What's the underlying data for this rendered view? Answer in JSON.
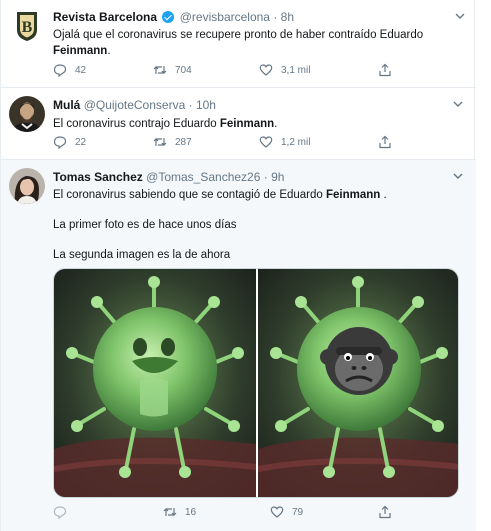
{
  "tweets": [
    {
      "name": "Revista Barcelona",
      "handle": "@revisbarcelona",
      "dot": "·",
      "time": "8h",
      "text_before": "Ojalá que el coronavirus se recupere pronto de haber contraído Eduardo ",
      "text_bold": "Feinmann",
      "text_after": ".",
      "reply_count": "42",
      "retweet_count": "704",
      "like_count": "3,1 mil"
    },
    {
      "name": "Mulá",
      "handle": "@QuijoteConserva",
      "dot": "·",
      "time": "10h",
      "text_before": "El coronavirus contrajo Eduardo ",
      "text_bold": "Feinmann",
      "text_after": ".",
      "reply_count": "22",
      "retweet_count": "287",
      "like_count": "1,2 mil"
    },
    {
      "name": "Tomas Sanchez",
      "handle": "@Tomas_Sanchez26",
      "dot": "·",
      "time": "9h",
      "text_before": "El coronavirus sabiendo que se contagió de Eduardo ",
      "text_bold": "Feinmann",
      "text_after": " .",
      "line2": "La primer foto es de hace unos días",
      "line3": "La segunda imagen es la de ahora",
      "reply_count": "",
      "retweet_count": "16",
      "like_count": "79"
    }
  ],
  "icons": {
    "reply": "reply-icon",
    "retweet": "retweet-icon",
    "like": "heart-icon",
    "share": "share-icon",
    "caret": "chevron-down-icon",
    "verified": "verified-badge-icon"
  },
  "colors": {
    "accent": "#1da1f2",
    "muted": "#657786",
    "highlight_bg": "#f5f8fa"
  }
}
